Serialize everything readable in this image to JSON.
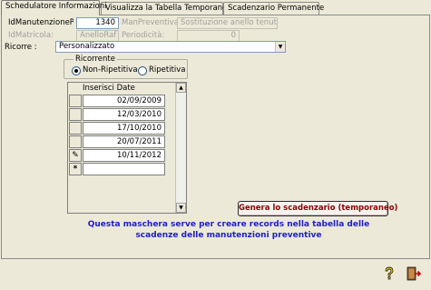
{
  "tabs": [
    {
      "label": "Schedulatore Informazioni",
      "active": true
    },
    {
      "label": "Visualizza la Tabella Temporanea",
      "active": false
    },
    {
      "label": "Scadenzario Permanente",
      "active": false
    }
  ],
  "form": {
    "id_manutenzione_label": "IdManutenzionePrev",
    "id_manutenzione_value": "1340",
    "man_preventiva_label": "ManPreventiva:",
    "man_preventiva_value": "Sostituzione  anello tenuta",
    "id_matricola_label": "IdMatricola:",
    "id_matricola_value": "AnelloRaf",
    "periodicita_label": "Periodicità:",
    "periodicita_value": "0",
    "ricorre_label": "Ricorre :",
    "ricorre_value": "Personalizzato"
  },
  "ricorrente": {
    "title": "Ricorrente",
    "option_non_ripetitiva": "Non-Ripetitiva",
    "option_ripetitiva": "Ripetitiva",
    "selected": "Non-Ripetitiva"
  },
  "dates_table": {
    "header": "Inserisci Date",
    "rows": [
      "02/09/2009",
      "12/03/2010",
      "17/10/2010",
      "20/07/2011",
      "10/11/2012"
    ]
  },
  "generate_button": "Genera lo scadenzario (temporaneo)",
  "note": "Questa maschera serve per creare records nella tabella delle scadenze delle manutenzioni preventive",
  "colors": {
    "note_text": "#1e1ec8",
    "button_text": "#8b0000",
    "background": "#ece9d8"
  },
  "icons": {
    "help": "question-mark-icon",
    "exit": "exit-door-icon",
    "edit_row": "pencil-icon",
    "new_row": "asterisk-icon"
  }
}
